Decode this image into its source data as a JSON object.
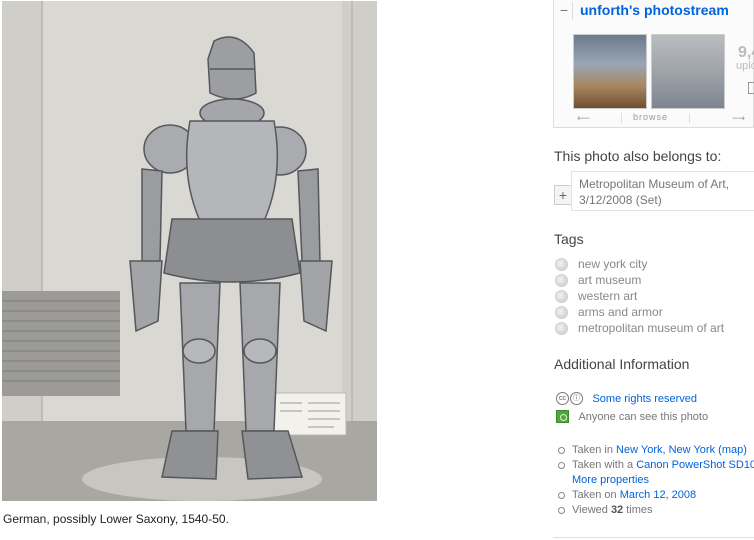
{
  "photo": {
    "caption": "German, possibly Lower Saxony, 1540-50."
  },
  "photostream": {
    "collapse_label": "−",
    "title": "unforth's photostream",
    "uploads_count": "9,4",
    "uploads_label": "uplo",
    "browse_label": "browse"
  },
  "also_belongs": {
    "heading": "This photo also belongs to:",
    "add_label": "+",
    "set_line1": "Metropolitan Museum of Art,",
    "set_line2": "3/12/2008 (Set)"
  },
  "tags": {
    "heading": "Tags",
    "items": [
      "new york city",
      "art museum",
      "western art",
      "arms and armor",
      "metropolitan museum of art"
    ]
  },
  "additional_info": {
    "heading": "Additional Information",
    "license_link": "Some rights reserved",
    "privacy_text": "Anyone can see this photo",
    "taken_in_prefix": "Taken in ",
    "taken_in_place": "New York, New York",
    "taken_in_map": "(map)",
    "taken_with_prefix": "Taken with a ",
    "camera": "Canon PowerShot SD10",
    "more_properties": "More properties",
    "taken_on_prefix": "Taken on ",
    "taken_on_date": "March 12, 2008",
    "viewed_prefix": "Viewed ",
    "viewed_count": "32",
    "viewed_suffix": " times"
  },
  "colors": {
    "link": "#0063dc",
    "privacy_green": "#4fa83d"
  },
  "icons": {
    "collapse": "minus-icon",
    "tag": "tag-globe-icon",
    "license": "creative-commons-icon",
    "privacy": "public-privacy-icon",
    "bullet": "circle-bullet-icon"
  }
}
